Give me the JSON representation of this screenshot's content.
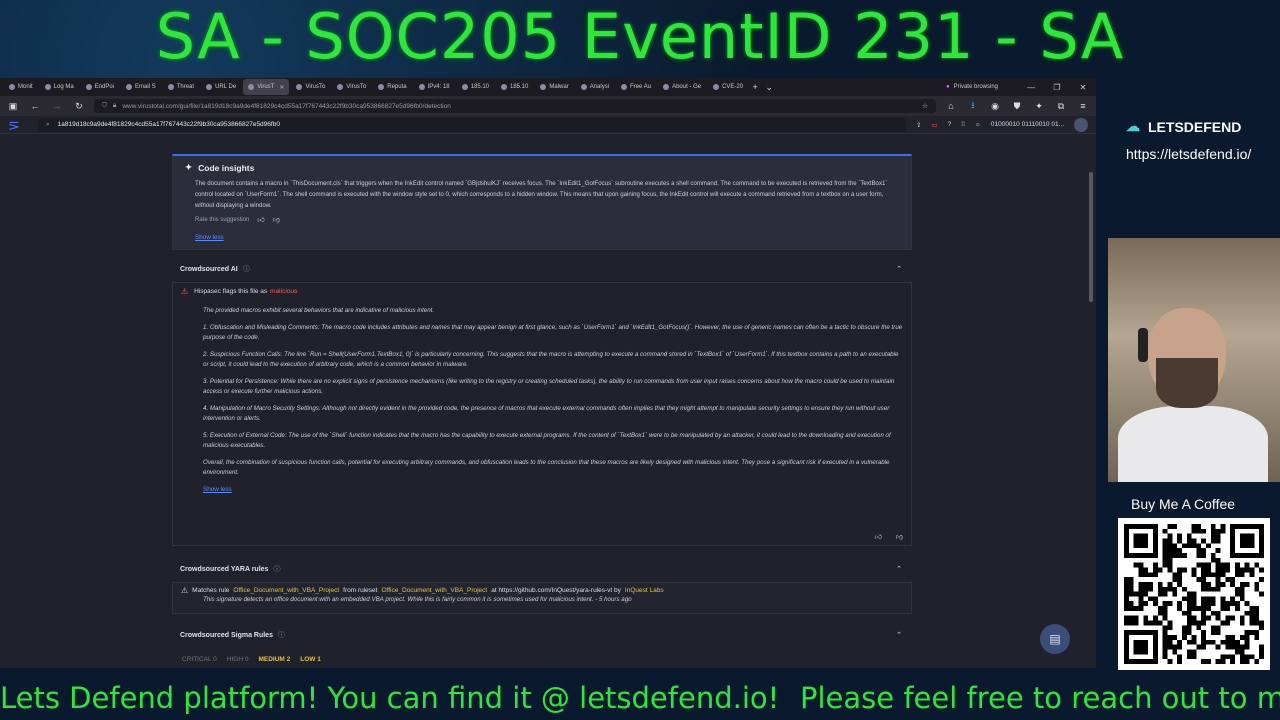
{
  "banner": {
    "title": "SA - SOC205 EventID 231 - SA"
  },
  "browser": {
    "tabs": [
      {
        "label": "Monit"
      },
      {
        "label": "Log Ma"
      },
      {
        "label": "EndPoi"
      },
      {
        "label": "Email S"
      },
      {
        "label": "Threat"
      },
      {
        "label": "URL De"
      },
      {
        "label": "VirusT",
        "active": true
      },
      {
        "label": "VirusTo"
      },
      {
        "label": "VirusTo"
      },
      {
        "label": "Reputa"
      },
      {
        "label": "IPv4: 18"
      },
      {
        "label": "185.10"
      },
      {
        "label": "185.10"
      },
      {
        "label": "Malwar"
      },
      {
        "label": "Analysi"
      },
      {
        "label": "Free Au"
      },
      {
        "label": "About - Ge"
      },
      {
        "label": "CVE-20"
      }
    ],
    "private_label": "Private browsing",
    "url": "www.virustotal.com/gui/file/1a819d18c9a9de4f81829c4cd55a17f767443c22f9b30ca953866827e5d96fb0/detection",
    "vt_search_value": "1a819d18c9a9de4f81829c4cd55a17f767443c22f9b30ca953866827e5d96fb0",
    "vt_user_text": "01000010 01110010 01..."
  },
  "insights": {
    "title": "Code insights",
    "text": "The document contains a macro in `ThisDocument.cls` that triggers when the InkEdit control named `GBjdshuiKJ` receives focus. The `InkEdit1_GotFocus` subroutine executes a shell command. The command to be executed is retrieved from the `TextBox1` control located on `UserForm1`. The shell command is executed with the window style set to 0, which corresponds to a hidden window. This means that upon gaining focus, the InkEdit control will execute a command retrieved from a textbox on a user form, without displaying a window.",
    "rate_label": "Rate this suggestion",
    "show_less": "Show less"
  },
  "crowd_ai": {
    "title": "Crowdsourced AI",
    "flag_prefix": "Hispasec flags this file as",
    "flag_value": "malicious",
    "intro": "The provided macros exhibit several behaviors that are indicative of malicious intent.",
    "points": [
      "1. Obfuscation and Misleading Comments: The macro code includes attributes and names that may appear benign at first glance, such as `UserForm1` and `InkEdit1_GotFocus()`. However, the use of generic names can often be a tactic to obscure the true purpose of the code.",
      "2. Suspicious Function Calls: The line `Run = Shell(UserForm1.TextBox1, 0)` is particularly concerning. This suggests that the macro is attempting to execute a command stored in `TextBox1` of `UserForm1`. If this textbox contains a path to an executable or script, it could lead to the execution of arbitrary code, which is a common behavior in malware.",
      "3. Potential for Persistence: While there are no explicit signs of persistence mechanisms (like writing to the registry or creating scheduled tasks), the ability to run commands from user input raises concerns about how the macro could be used to maintain access or execute further malicious actions.",
      "4. Manipulation of Macro Security Settings: Although not directly evident in the provided code, the presence of macros that execute external commands often implies that they might attempt to manipulate security settings to ensure they run without user intervention or alerts.",
      "5. Execution of External Code: The use of the `Shell` function indicates that the macro has the capability to execute external programs. If the content of `TextBox1` were to be manipulated by an attacker, it could lead to the downloading and execution of malicious executables."
    ],
    "conclusion": "Overall, the combination of suspicious function calls, potential for executing arbitrary commands, and obfuscation leads to the conclusion that these macros are likely designed with malicious intent. They pose a significant risk if executed in a vulnerable environment.",
    "show_less": "Show less"
  },
  "yara": {
    "title": "Crowdsourced YARA rules",
    "matches_prefix": "Matches rule",
    "rule": "Office_Document_with_VBA_Project",
    "from_ruleset": "from ruleset",
    "ruleset": "Office_Document_with_VBA_Project",
    "at_url": "at https://github.com/InQuest/yara-rules-vt by",
    "author": "InQuest Labs",
    "description": "This signature detects an office document with an embedded VBA project. While this is fairly common it is sometimes used for malicious intent. - 5 hours ago"
  },
  "sigma": {
    "title": "Crowdsourced Sigma Rules",
    "severities": [
      {
        "label": "CRITICAL 0"
      },
      {
        "label": "HIGH 0"
      },
      {
        "label": "MEDIUM 2"
      },
      {
        "label": "LOW 1"
      }
    ]
  },
  "side": {
    "brand": "LETSDEFEND",
    "url": "https://letsdefend.io/",
    "coffee": "Buy Me A Coffee"
  },
  "ticker": {
    "left": "Lets Defend platform! You can find it @ letsdefend.io!",
    "right": "Please feel free to reach out to me with que"
  },
  "colors": {
    "banner": "#2be83a",
    "vt_accent": "#3a6df0",
    "malicious": "#ff5a5a",
    "medium": "#e7c23a"
  }
}
